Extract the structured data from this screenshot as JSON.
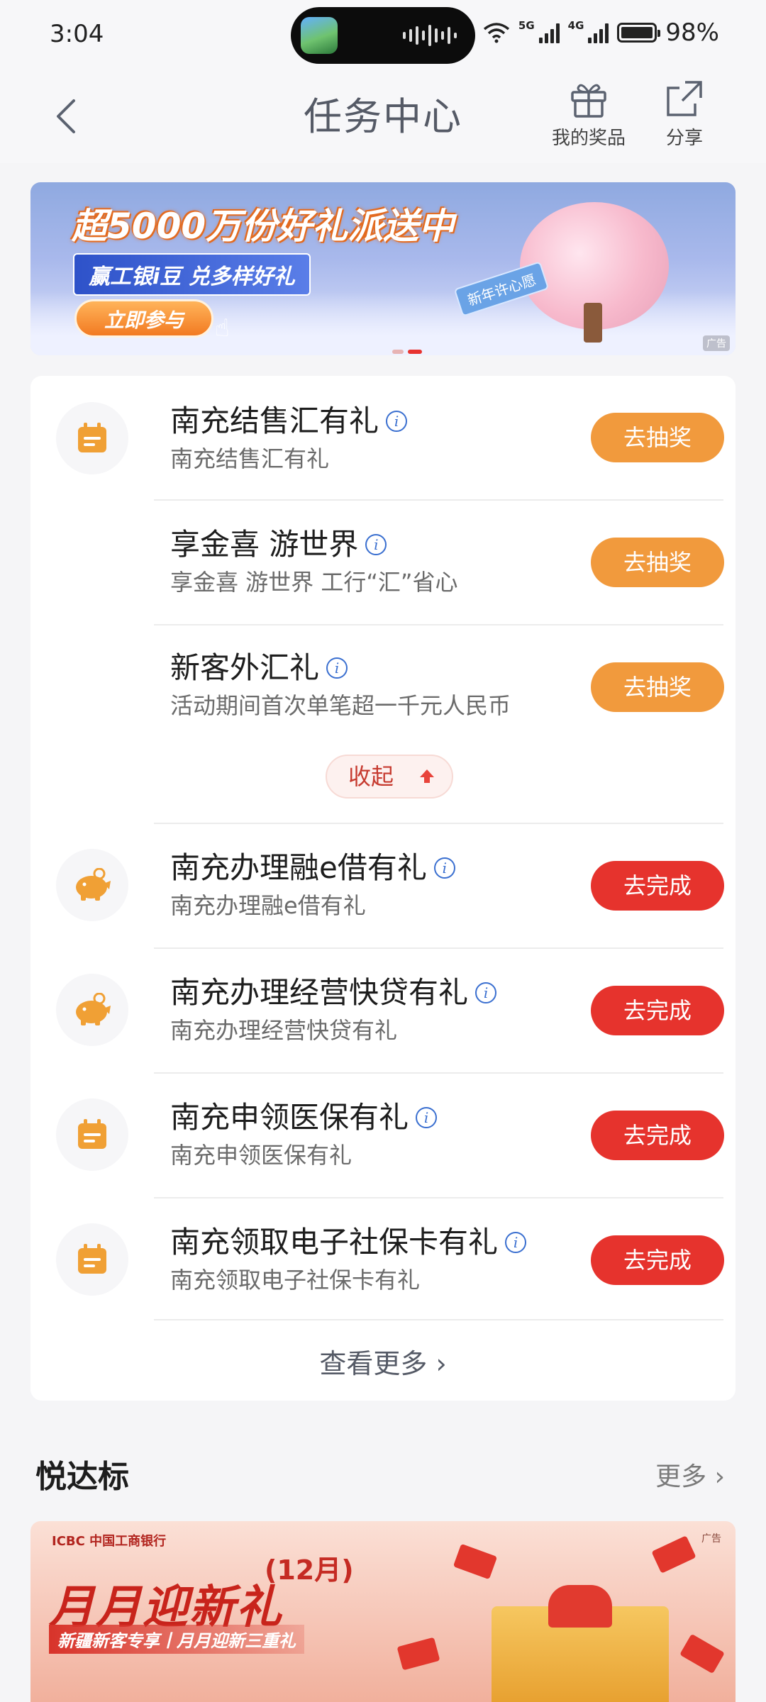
{
  "status_bar": {
    "time": "3:04",
    "net1": "5G",
    "net2": "4G",
    "battery": "98%",
    "battery_level": 0.98
  },
  "header": {
    "title": "任务中心",
    "prizes_label": "我的奖品",
    "share_label": "分享"
  },
  "banner": {
    "title": "超5000万份好礼派送中",
    "subtitle": "赢工银i豆 兑多样好礼",
    "cta": "立即参与",
    "tag": "新年许心愿",
    "ad_label": "广告"
  },
  "tasks": {
    "items": [
      {
        "title": "南充结售汇有礼",
        "subtitle": "南充结售汇有礼",
        "button": "去抽奖",
        "icon": "calendar-icon",
        "status": "lottery"
      },
      {
        "title": "享金喜 游世界",
        "subtitle": "享金喜 游世界 工行“汇”省心",
        "button": "去抽奖",
        "status": "lottery"
      },
      {
        "title": "新客外汇礼",
        "subtitle": "活动期间首次单笔超一千元人民币",
        "button": "去抽奖",
        "status": "lottery"
      },
      {
        "title": "南充办理融e借有礼",
        "subtitle": "南充办理融e借有礼",
        "button": "去完成",
        "icon": "piggy-bank-icon",
        "status": "todo"
      },
      {
        "title": "南充办理经营快贷有礼",
        "subtitle": "南充办理经营快贷有礼",
        "button": "去完成",
        "icon": "piggy-bank-icon",
        "status": "todo"
      },
      {
        "title": "南充申领医保有礼",
        "subtitle": "南充申领医保有礼",
        "button": "去完成",
        "icon": "calendar-icon",
        "status": "todo"
      },
      {
        "title": "南充领取电子社保卡有礼",
        "subtitle": "南充领取电子社保卡有礼",
        "button": "去完成",
        "icon": "calendar-icon",
        "status": "todo"
      }
    ],
    "collapse_label": "收起",
    "see_more_label": "查看更多"
  },
  "section": {
    "title": "悦达标",
    "more_label": "更多"
  },
  "promo": {
    "bank": "ICBC 中国工商银行",
    "month": "(12月)",
    "title": "月月迎新礼",
    "subtitle": "新疆新客专享丨月月迎新三重礼",
    "ad_label": "广告"
  },
  "colors": {
    "orange_button": "#f19a3d",
    "red_button": "#e6332d",
    "icon_orange": "#f0a035",
    "info_blue": "#3a6fd0"
  }
}
